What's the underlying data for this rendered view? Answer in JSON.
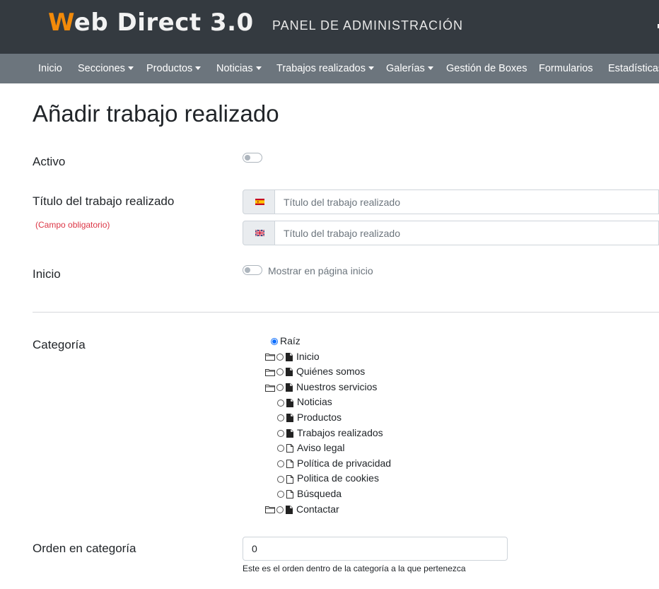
{
  "header": {
    "brand_initial": "W",
    "brand_rest": "eb Direct 3.0",
    "subtitle": "PANEL DE ADMINISTRACIÓN"
  },
  "nav": [
    {
      "label": "Inicio",
      "dropdown": false
    },
    {
      "label": "Secciones",
      "dropdown": true
    },
    {
      "label": "Productos",
      "dropdown": true
    },
    {
      "label": "Noticias",
      "dropdown": true
    },
    {
      "label": "Trabajos realizados",
      "dropdown": true
    },
    {
      "label": "Galerías",
      "dropdown": true
    },
    {
      "label": "Gestión de Boxes",
      "dropdown": false
    },
    {
      "label": "Formularios",
      "dropdown": false
    },
    {
      "label": "Estadísticas",
      "dropdown": false
    }
  ],
  "form": {
    "title": "Añadir trabajo realizado",
    "activo": {
      "label": "Activo",
      "checked": false
    },
    "titulo": {
      "label": "Título del trabajo realizado",
      "required_note": "(Campo obligatorio)",
      "es": {
        "flag": "es-flag",
        "placeholder": "Título del trabajo realizado",
        "value": ""
      },
      "en": {
        "flag": "uk-flag",
        "placeholder": "Título del trabajo realizado",
        "value": ""
      }
    },
    "inicio": {
      "label": "Inicio",
      "toggle_text": "Mostrar en página inicio",
      "checked": false
    },
    "categoria": {
      "label": "Categoría",
      "items": [
        {
          "label": "Raíz",
          "folder": false,
          "doc": "none",
          "selected": true
        },
        {
          "label": "Inicio",
          "folder": true,
          "doc": "filled",
          "selected": false
        },
        {
          "label": "Quiénes somos",
          "folder": true,
          "doc": "filled",
          "selected": false
        },
        {
          "label": "Nuestros servicios",
          "folder": true,
          "doc": "filled",
          "selected": false
        },
        {
          "label": "Noticias",
          "folder": false,
          "doc": "filled",
          "selected": false
        },
        {
          "label": "Productos",
          "folder": false,
          "doc": "filled",
          "selected": false
        },
        {
          "label": "Trabajos realizados",
          "folder": false,
          "doc": "filled",
          "selected": false
        },
        {
          "label": "Aviso legal",
          "folder": false,
          "doc": "outline",
          "selected": false
        },
        {
          "label": "Política de privacidad",
          "folder": false,
          "doc": "outline",
          "selected": false
        },
        {
          "label": "Politica de cookies",
          "folder": false,
          "doc": "outline",
          "selected": false
        },
        {
          "label": "Búsqueda",
          "folder": false,
          "doc": "outline",
          "selected": false
        },
        {
          "label": "Contactar",
          "folder": true,
          "doc": "filled",
          "selected": false
        }
      ]
    },
    "orden": {
      "label": "Orden en categoría",
      "value": "0",
      "help": "Este es el orden dentro de la categoría a la que pertenezca"
    }
  }
}
